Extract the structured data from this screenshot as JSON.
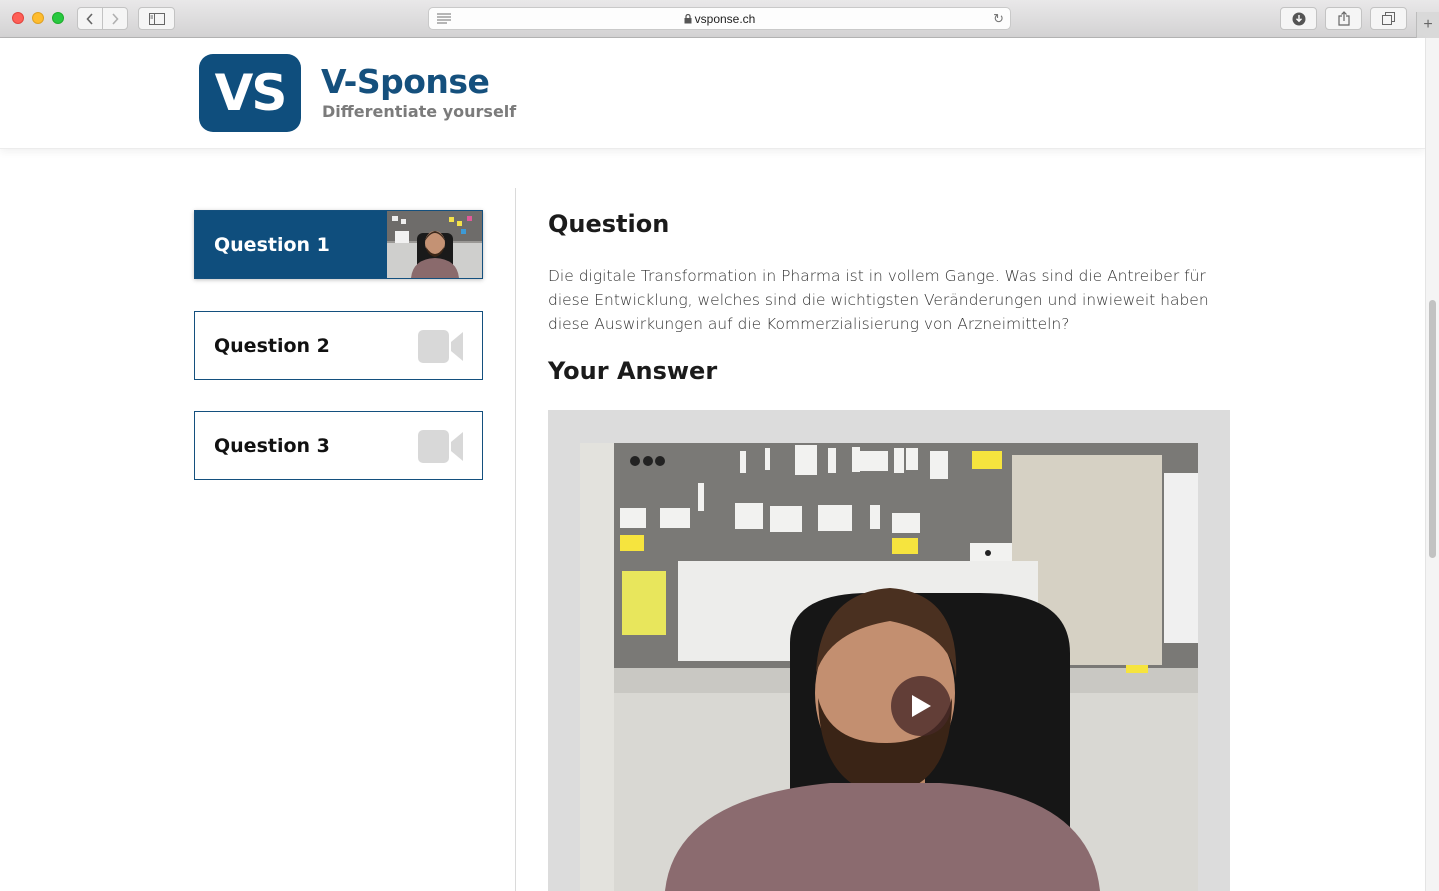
{
  "browser": {
    "url": "vsponse.ch",
    "new_tab_symbol": "+"
  },
  "site": {
    "logo_text": "VS",
    "name": "V-Sponse",
    "tagline": "Differentiate yourself",
    "brand_color": "#0f4e7d"
  },
  "sidebar": {
    "questions": [
      {
        "label": "Question 1",
        "active": true,
        "has_video": true
      },
      {
        "label": "Question 2",
        "active": false,
        "icon": "video-camera-icon"
      },
      {
        "label": "Question 3",
        "active": false,
        "icon": "video-camera-icon"
      }
    ]
  },
  "main": {
    "question_heading": "Question",
    "question_text": "Die digitale Transformation in Pharma ist in vollem Gange. Was sind die Antreiber für diese Entwicklung, welches sind die wichtigsten Veränderungen und inwieweit haben diese Auswirkungen auf die Kommerzialisierung von Arzneimitteln?",
    "answer_heading": "Your Answer",
    "video_state": "paused"
  }
}
